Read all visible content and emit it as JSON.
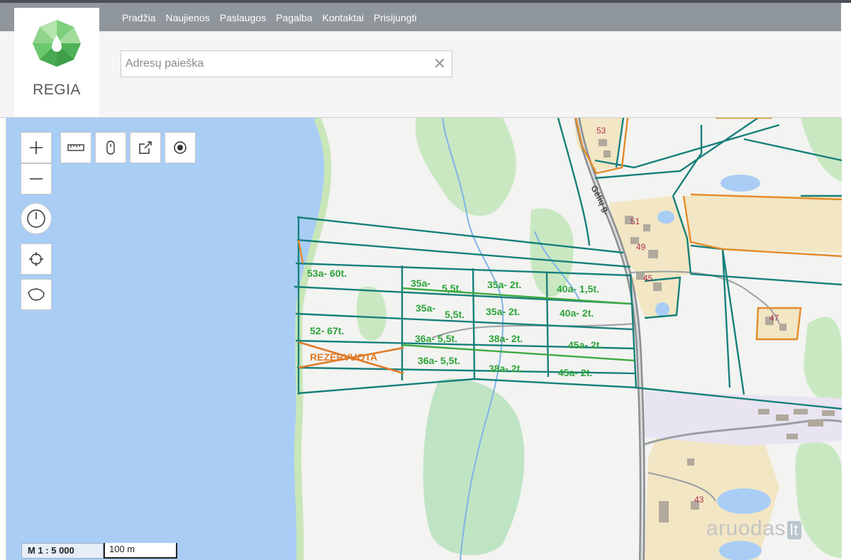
{
  "nav": {
    "items": [
      "Pradžia",
      "Naujienos",
      "Paslaugos",
      "Pagalba",
      "Kontaktai",
      "Prisijungti"
    ]
  },
  "logo": {
    "text": "REGIA"
  },
  "search": {
    "placeholder": "Adresų paieška",
    "value": ""
  },
  "toolbar": {
    "zoom_in_icon": "plus-icon",
    "zoom_out_icon": "minus-icon",
    "tools": [
      "ruler-icon",
      "marker-icon",
      "share-icon",
      "record-icon"
    ],
    "side_tools": [
      "power-icon",
      "locate-icon",
      "lithuania-outline-icon"
    ]
  },
  "scale": {
    "ratio": "M 1 : 5 000",
    "bar": "100 m"
  },
  "watermark": {
    "text": "aruodas",
    "badge": "lt"
  },
  "map": {
    "street_label": "Gėlių g.",
    "house_numbers": [
      "53",
      "51",
      "49",
      "45",
      "47",
      "43"
    ],
    "plots": [
      {
        "label": "53a- 60t."
      },
      {
        "label": "35a-"
      },
      {
        "label": "5,5t."
      },
      {
        "label": "35a- 2t."
      },
      {
        "label": "40a- 1,5t."
      },
      {
        "label": "35a-"
      },
      {
        "label": "5,5t."
      },
      {
        "label": "35a- 2t."
      },
      {
        "label": "40a- 2t."
      },
      {
        "label": "52- 67t."
      },
      {
        "label": "36a- 5,5t."
      },
      {
        "label": "38a- 2t."
      },
      {
        "label": "45a- 2t."
      },
      {
        "label": "36a- 5,5t."
      },
      {
        "label": "38a- 2t."
      },
      {
        "label": "45a- 2t."
      }
    ],
    "reserved_label": "REZERVUOTA",
    "colors": {
      "water": "#a9cdf5",
      "forest": "#c9e8c2",
      "parcel_line": "#16807a",
      "orange_line": "#e38b2a",
      "green_line": "#3daa3f",
      "label_green": "#2ea33a",
      "label_orange": "#e07a28"
    }
  }
}
